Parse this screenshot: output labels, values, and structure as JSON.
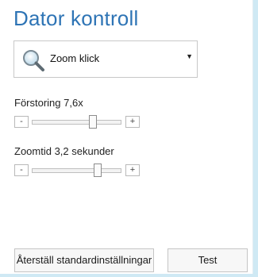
{
  "title": "Dator kontroll",
  "mode_dropdown": {
    "selected": "Zoom klick",
    "icon": "magnifier-icon"
  },
  "magnification": {
    "label": "Förstoring 7,6x",
    "minus": "-",
    "plus": "+",
    "level": 0.68
  },
  "zoom_time": {
    "label": "Zoomtid 3,2 sekunder",
    "minus": "-",
    "plus": "+",
    "level": 0.69
  },
  "buttons": {
    "reset": "Återställ standardinställningar",
    "test": "Test"
  }
}
